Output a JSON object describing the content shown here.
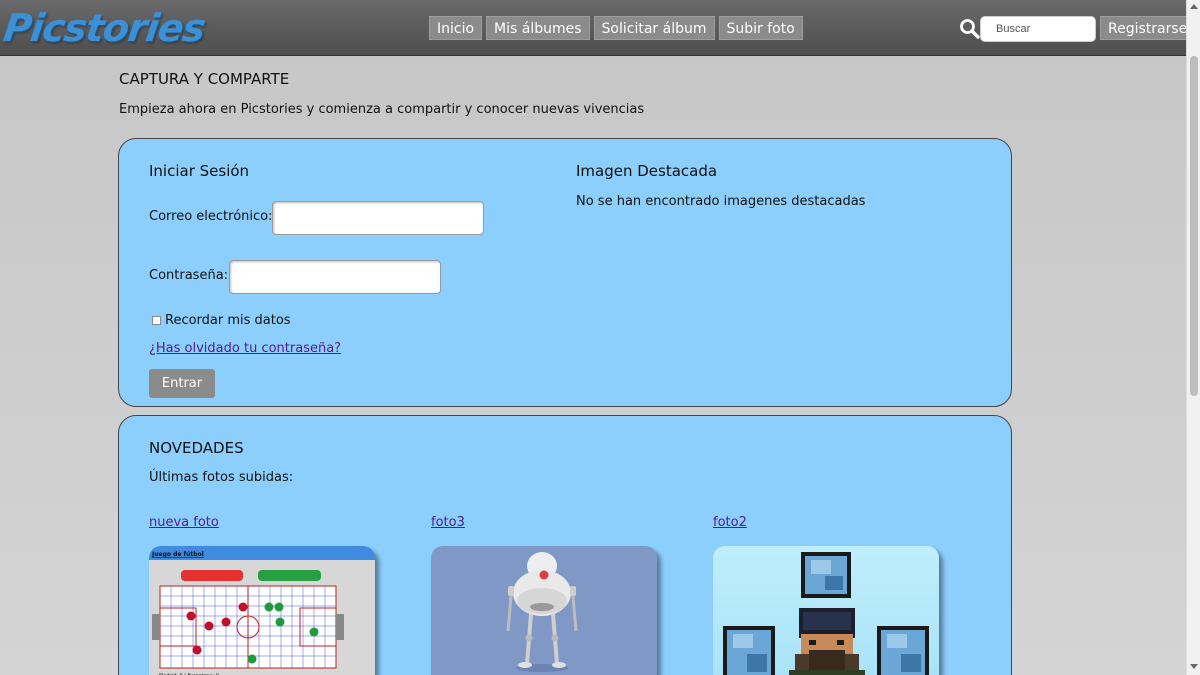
{
  "header": {
    "logo": "Picstories",
    "nav": [
      "Inicio",
      "Mis álbumes",
      "Solicitar álbum",
      "Subir foto"
    ],
    "search_placeholder": "Buscar",
    "register_label": "Registrarse"
  },
  "intro": {
    "title": "CAPTURA Y COMPARTE",
    "text": "Empieza ahora en Picstories y comienza a compartir y conocer nuevas vivencias"
  },
  "login": {
    "title": "Iniciar Sesión",
    "email_label": "Correo electrónico:",
    "password_label": "Contraseña:",
    "remember_label": "Recordar mis datos",
    "forgot_link": "¿Has olvidado tu contraseña?",
    "submit_label": "Entrar"
  },
  "featured": {
    "title": "Imagen Destacada",
    "empty_message": "No se han encontrado imagenes destacadas"
  },
  "news": {
    "title": "NOVEDADES",
    "subtitle": "Últimas fotos subidas:",
    "photos": [
      {
        "title": "nueva foto",
        "image_text": "Juego de fútbol",
        "subject": "football-game-screenshot"
      },
      {
        "title": "foto3",
        "subject": "robot-render"
      },
      {
        "title": "foto2",
        "subject": "pixel-art-character-with-blue-gems"
      }
    ]
  },
  "colors": {
    "panel_bg": "#8ccffd",
    "header_bg": "#5a5a5a",
    "nav_bg": "#8b8b8b",
    "link": "#551a8b",
    "logo": "#3d8fd6"
  }
}
